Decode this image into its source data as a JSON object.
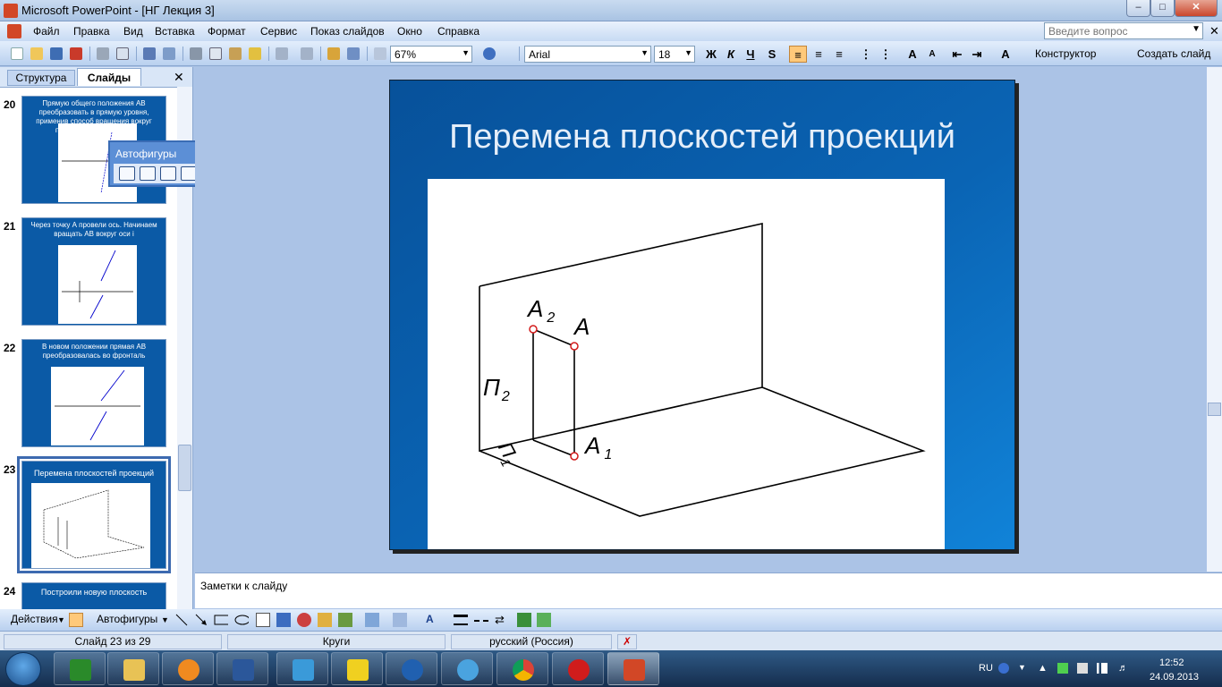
{
  "window": {
    "title": "Microsoft PowerPoint - [НГ Лекция 3]",
    "min": "–",
    "max": "□",
    "close": "✕"
  },
  "menu": {
    "items": [
      "Файл",
      "Правка",
      "Вид",
      "Вставка",
      "Формат",
      "Сервис",
      "Показ слайдов",
      "Окно",
      "Справка"
    ],
    "help_placeholder": "Введите вопрос",
    "close": "✕"
  },
  "toolbar": {
    "zoom": "67%",
    "font": "Arial",
    "font_size": "18",
    "bold": "Ж",
    "italic": "К",
    "underline": "Ч",
    "shadow": "S",
    "designer": "Конструктор",
    "new_slide": "Создать слайд"
  },
  "left_panel": {
    "tab_outline": "Структура",
    "tab_slides": "Слайды",
    "close": "✕",
    "thumbnails": [
      {
        "num": "20",
        "title": "Прямую общего положения АВ преобразовать в прямую уровня, применив способ вращения вокруг проецирующей прямой"
      },
      {
        "num": "21",
        "title": "Через точку А провели ось. Начинаем вращать АВ вокруг оси i"
      },
      {
        "num": "22",
        "title": "В новом положении прямая АВ преобразовалась во фронталь"
      },
      {
        "num": "23",
        "title": "Перемена плоскостей проекций"
      },
      {
        "num": "24",
        "title": "Построили новую плоскость"
      }
    ],
    "selected_index": 3
  },
  "autoshapes_toolbar": {
    "title": "Автофигуры",
    "close": "✕",
    "menu": "▼",
    "buttons": [
      "lines-icon",
      "connectors-icon",
      "basic-shapes-icon",
      "block-arrows-icon",
      "flowchart-icon",
      "stars-banners-icon",
      "callouts-icon",
      "action-buttons-icon",
      "more-autoshapes-icon"
    ]
  },
  "slide": {
    "title": "Перемена плоскостей проекций",
    "labels": {
      "a2": "A",
      "a2_sub": "2",
      "a": "A",
      "p2": "П",
      "p2_sub": "2",
      "p1": "П",
      "p1_sub": "1",
      "a1": "A",
      "a1_sub": "1"
    }
  },
  "notes": {
    "placeholder": "Заметки к слайду"
  },
  "drawing_toolbar": {
    "actions": "Действия",
    "autoshapes": "Автофигуры"
  },
  "status": {
    "slide": "Слайд 23 из 29",
    "design": "Круги",
    "language": "русский (Россия)"
  },
  "taskbar": {
    "apps": [
      "task-manager-icon",
      "explorer-icon",
      "media-player-icon",
      "word-icon",
      "edge-app-icon",
      "batman-icon",
      "browser-app-icon",
      "kde-icon",
      "chrome-icon",
      "opera-icon",
      "powerpoint-icon"
    ],
    "lang": "RU",
    "time": "12:52",
    "date": "24.09.2013"
  },
  "colors": {
    "slide_bg": "#0a64b4",
    "accent": "#d24726",
    "marker_red": "#d21a1a"
  }
}
